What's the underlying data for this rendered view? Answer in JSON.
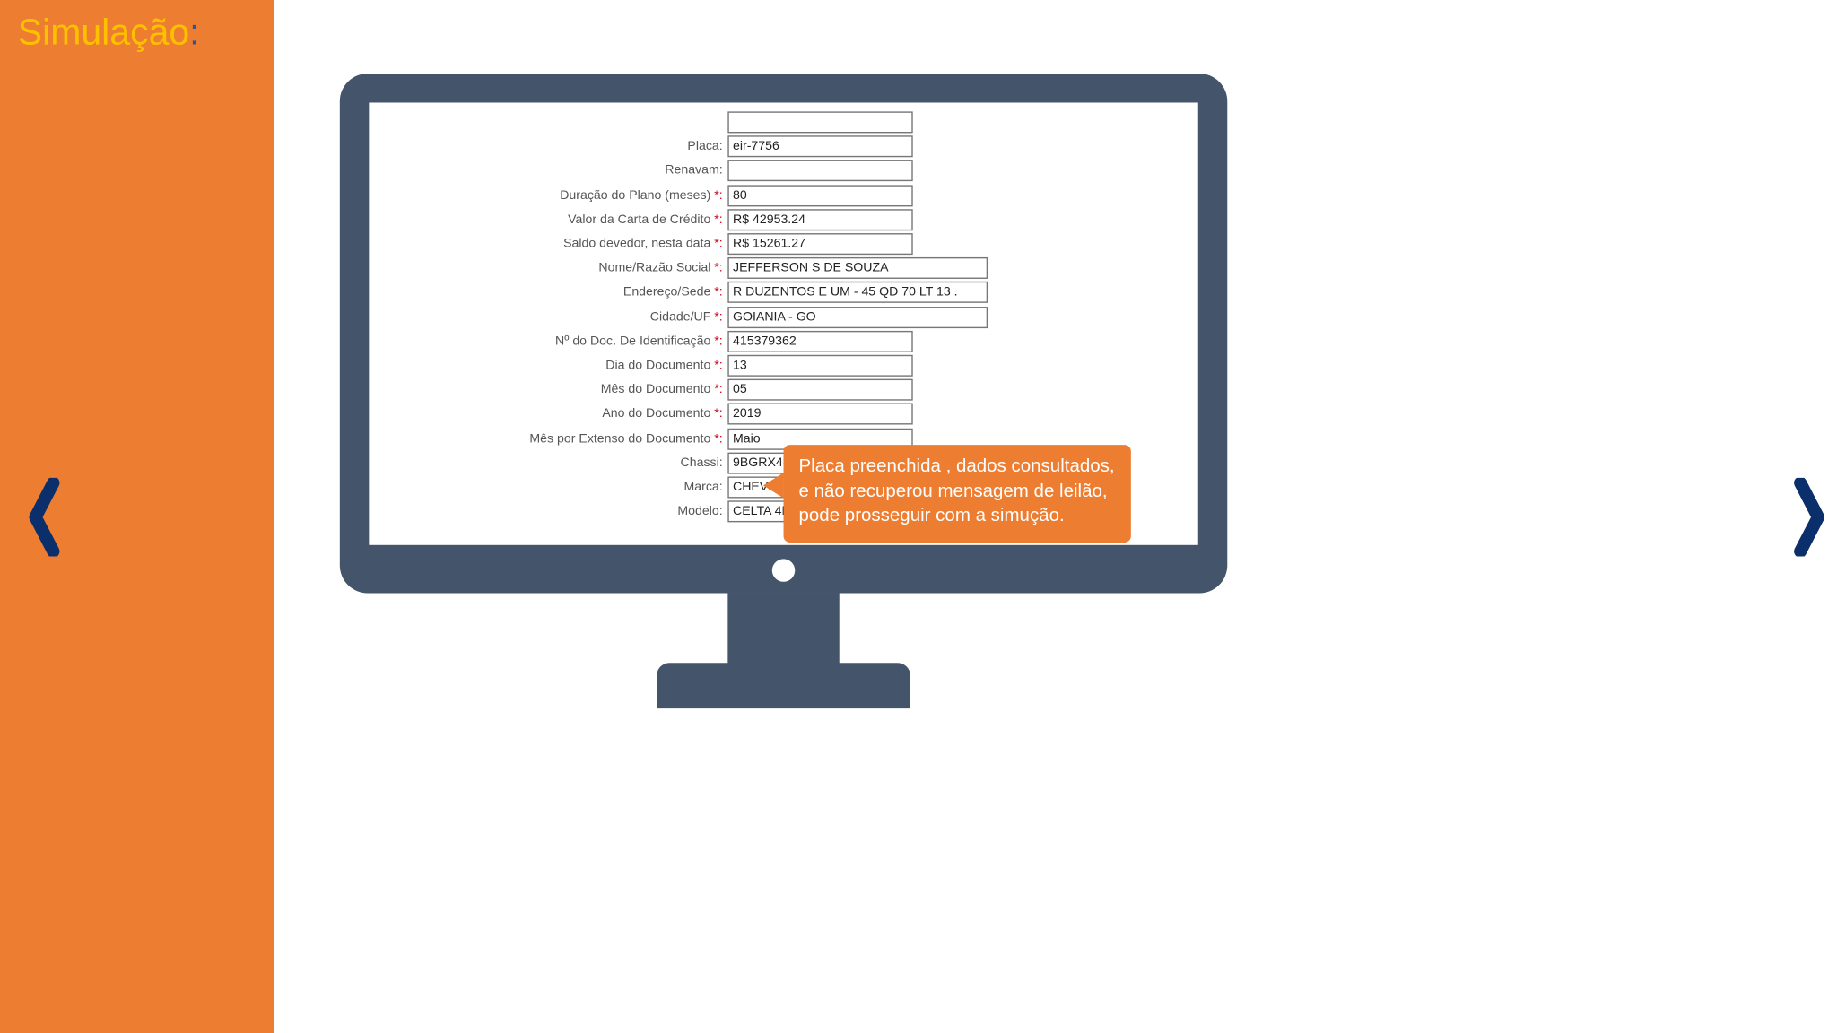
{
  "title": {
    "text": "Simulação",
    "colon": ":"
  },
  "callout": {
    "line1": "Placa preenchida , dados consultados,",
    "line2": "e não recuperou mensagem de leilão,",
    "line3": "pode prosseguir com a simução."
  },
  "form": {
    "rows": [
      {
        "label": "",
        "required": false,
        "value": "",
        "width": "w-std"
      },
      {
        "label": "Placa:",
        "required": false,
        "value": "eir-7756",
        "width": "w-std"
      },
      {
        "label": "Renavam:",
        "required": false,
        "value": "",
        "width": "w-std"
      },
      {
        "label": "Duração do Plano (meses) ",
        "required": true,
        "value": "80",
        "width": "w-std"
      },
      {
        "label": "Valor da Carta de Crédito ",
        "required": true,
        "value": "R$ 42953.24",
        "width": "w-std"
      },
      {
        "label": "Saldo devedor, nesta data ",
        "required": true,
        "value": "R$ 15261.27",
        "width": "w-std"
      },
      {
        "label": "Nome/Razão Social ",
        "required": true,
        "value": "JEFFERSON S DE SOUZA",
        "width": "w-wide"
      },
      {
        "label": "Endereço/Sede ",
        "required": true,
        "value": "R DUZENTOS E UM - 45 QD 70 LT 13 .",
        "width": "w-wide"
      },
      {
        "label": "Cidade/UF ",
        "required": true,
        "value": "GOIANIA - GO",
        "width": "w-wide"
      },
      {
        "label": "Nº do Doc. De Identificação ",
        "required": true,
        "value": "415379362",
        "width": "w-std"
      },
      {
        "label": "Dia do Documento ",
        "required": true,
        "value": "13",
        "width": "w-std"
      },
      {
        "label": "Mês do Documento ",
        "required": true,
        "value": "05",
        "width": "w-std"
      },
      {
        "label": "Ano do Documento ",
        "required": true,
        "value": "2019",
        "width": "w-std"
      },
      {
        "label": "Mês por Extenso do Documento ",
        "required": true,
        "value": "Maio",
        "width": "w-std"
      },
      {
        "label": "Chassi:",
        "required": false,
        "value": "9BGRX48F0AG327522",
        "width": "w-std"
      },
      {
        "label": "Marca:",
        "required": false,
        "value": "CHEVROLET",
        "width": "w-std"
      },
      {
        "label": "Modelo:",
        "required": false,
        "value": "CELTA 4P SPIRIT",
        "width": "w-std"
      }
    ]
  },
  "colors": {
    "orange": "#ED7D31",
    "navy": "#0B2F6B"
  }
}
